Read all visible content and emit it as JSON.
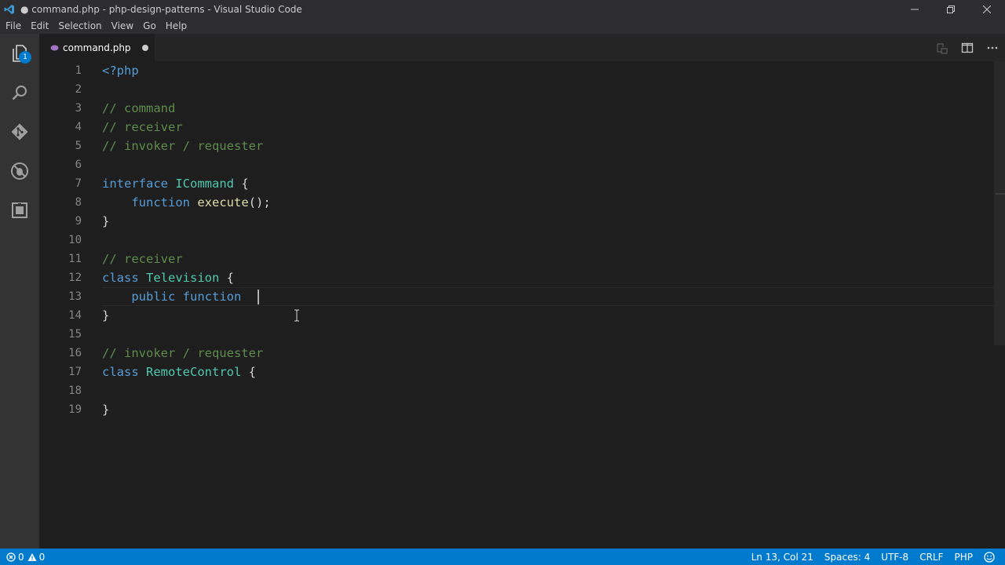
{
  "window": {
    "title": "● command.php - php-design-patterns - Visual Studio Code"
  },
  "menu": [
    "File",
    "Edit",
    "Selection",
    "View",
    "Go",
    "Help"
  ],
  "activity_bar": {
    "explorer_badge": "1",
    "icons": [
      "files-icon",
      "search-icon",
      "git-icon",
      "debug-icon",
      "extensions-icon"
    ]
  },
  "tab": {
    "label": "command.php",
    "dirty": true
  },
  "editor": {
    "line_numbers": [
      "1",
      "2",
      "3",
      "4",
      "5",
      "6",
      "7",
      "8",
      "9",
      "10",
      "11",
      "12",
      "13",
      "14",
      "15",
      "16",
      "17",
      "18",
      "19"
    ],
    "lines": [
      "<?php",
      "",
      "// command",
      "// receiver",
      "// invoker / requester",
      "",
      "interface ICommand {",
      "    function execute();",
      "}",
      "",
      "// receiver",
      "class Television {",
      "    public function ",
      "}",
      "",
      "// invoker / requester",
      "class RemoteControl {",
      "",
      "}"
    ],
    "current_line": 13
  },
  "status_bar": {
    "errors": "0",
    "warnings": "0",
    "position": "Ln 13, Col 21",
    "indent": "Spaces: 4",
    "encoding": "UTF-8",
    "eol": "CRLF",
    "language": "PHP"
  },
  "colors": {
    "accent": "#007acc",
    "keyword": "#569cd6",
    "comment": "#608b4e",
    "function": "#dcdcaa",
    "class": "#4ec9b0"
  }
}
